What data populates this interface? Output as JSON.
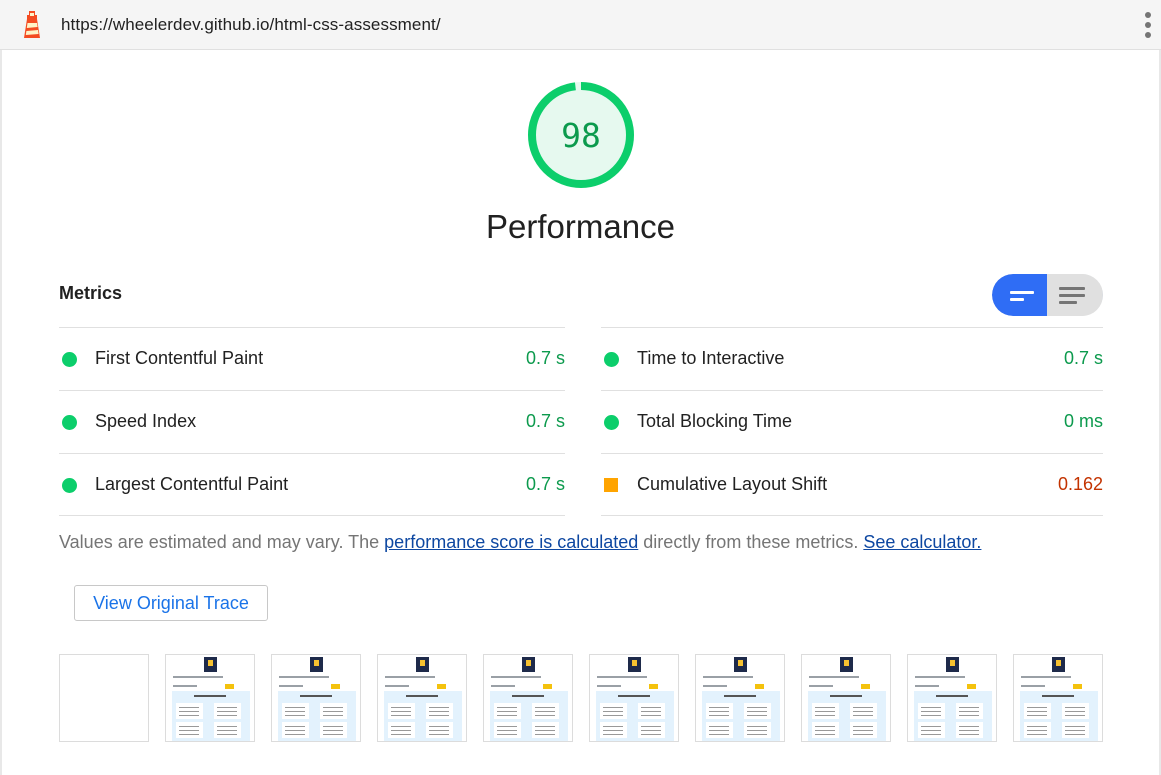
{
  "address_bar": {
    "url": "https://wheelerdev.github.io/html-css-assessment/",
    "logo_icon": "lighthouse-icon",
    "menu_icon": "more-vert-icon"
  },
  "score": {
    "value": "98",
    "fraction": 0.98,
    "category": "Performance",
    "color": "#0cce6b"
  },
  "metrics": {
    "header": "Metrics",
    "toggle": {
      "active": "compact-view-icon",
      "inactive": "expanded-view-icon",
      "accent": "#2f6df5"
    },
    "left": [
      {
        "name": "First Contentful Paint",
        "value": "0.7 s",
        "status": "pass"
      },
      {
        "name": "Speed Index",
        "value": "0.7 s",
        "status": "pass"
      },
      {
        "name": "Largest Contentful Paint",
        "value": "0.7 s",
        "status": "pass"
      }
    ],
    "right": [
      {
        "name": "Time to Interactive",
        "value": "0.7 s",
        "status": "pass"
      },
      {
        "name": "Total Blocking Time",
        "value": "0 ms",
        "status": "pass"
      },
      {
        "name": "Cumulative Layout Shift",
        "value": "0.162",
        "status": "average"
      }
    ],
    "colors": {
      "pass": "#0cce6b",
      "pass_text": "#0c9a4d",
      "average": "#ffa400",
      "average_text": "#c33300"
    }
  },
  "note": {
    "prefix": "Values are estimated and may vary. The ",
    "link1": "performance score is calculated",
    "middle": " directly from these metrics. ",
    "link2": "See calculator."
  },
  "trace_button": "View Original Trace",
  "filmstrip": {
    "frames": 10,
    "blank_frames": 1
  }
}
